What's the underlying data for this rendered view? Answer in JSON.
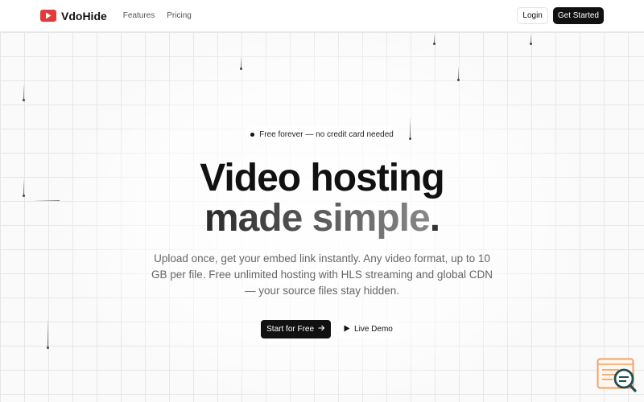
{
  "header": {
    "brand": "VdoHide",
    "nav": [
      "Features",
      "Pricing"
    ],
    "login_label": "Login",
    "get_started_label": "Get Started"
  },
  "hero": {
    "badge": "Free forever — no credit card needed",
    "title_line1": "Video hosting",
    "title_line2_main": "made simple",
    "title_line2_dot": ".",
    "description": "Upload once, get your embed link instantly. Any video format, up to 10 GB per file. Free unlimited hosting with HLS streaming and global CDN — your source files stay hidden.",
    "start_label": "Start for Free",
    "demo_label": "Live Demo"
  },
  "colors": {
    "brand_red": "#e23b3b",
    "primary_dark": "#111111",
    "widget_orange": "#f0a46a",
    "widget_teal": "#1f4f55"
  },
  "icons": {
    "logo": "play-logo-icon",
    "badge": "dot-icon",
    "start": "arrow-right-icon",
    "demo": "play-icon",
    "widget": "chat-search-icon"
  }
}
